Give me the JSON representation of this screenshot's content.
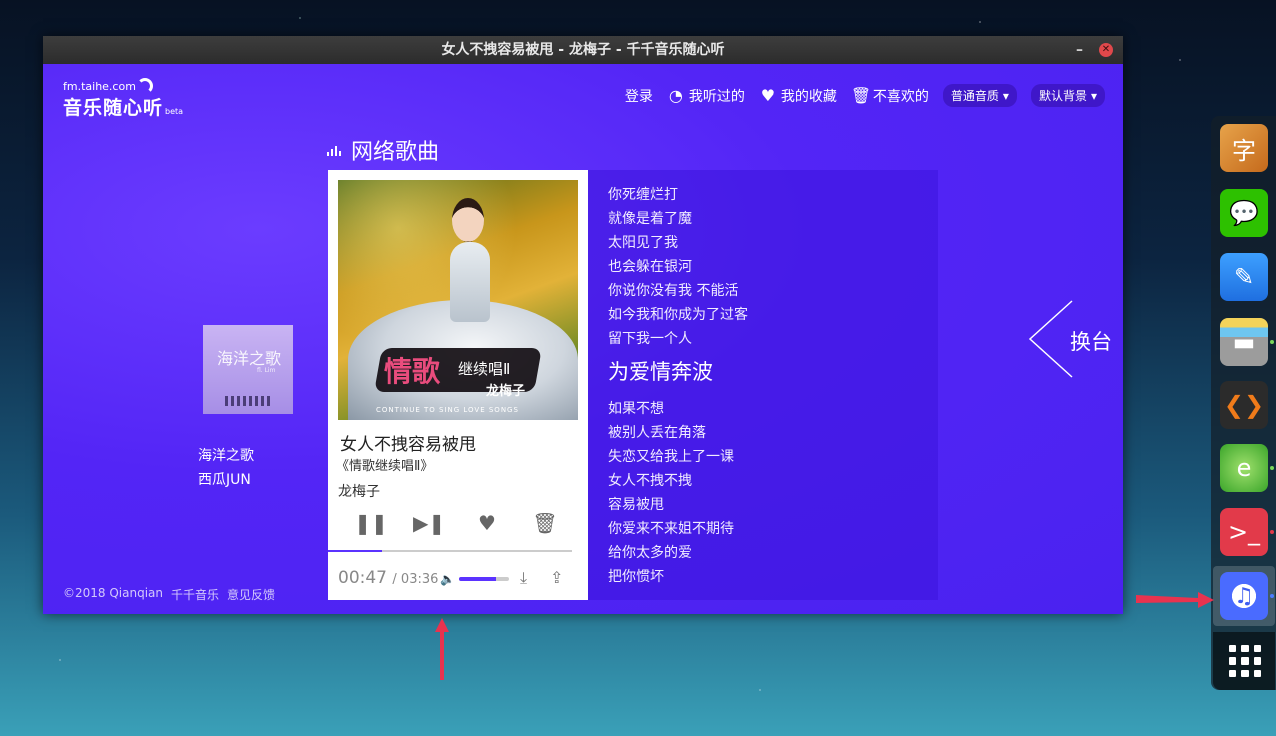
{
  "window": {
    "title": "女人不拽容易被甩 - 龙梅子 - 千千音乐随心听",
    "min": "–",
    "close": "✕"
  },
  "logo": {
    "url": "fm.taihe.com",
    "name": "音乐随心听",
    "tag": "beta"
  },
  "nav": {
    "login": "登录",
    "history": "我听过的",
    "favorites": "我的收藏",
    "disliked": "不喜欢的",
    "quality": "普通音质",
    "background": "默认背景"
  },
  "section_title": "网络歌曲",
  "previous": {
    "cover_text": "海洋之歌",
    "cover_sub": "fl. Lim",
    "title": "海洋之歌",
    "artist": "西瓜JUN"
  },
  "now_playing": {
    "cover_title": "情歌",
    "cover_subtitle": "继续唱Ⅱ",
    "cover_artist": "龙梅子",
    "cover_english": "CONTINUE TO SING LOVE SONGS",
    "title": "女人不拽容易被甩",
    "album": "《情歌继续唱Ⅱ》",
    "artist": "龙梅子",
    "elapsed": "00:47",
    "duration": "/ 03:36",
    "progress": 0.22,
    "volume": 0.75
  },
  "lyrics": {
    "lines_before": [
      "你死缠烂打",
      "就像是着了魔",
      "太阳见了我",
      "也会躲在银河",
      "你说你没有我 不能活",
      "如今我和你成为了过客",
      "留下我一个人"
    ],
    "current": "为爱情奔波",
    "lines_after": [
      "如果不想",
      "被别人丢在角落",
      "失恋又给我上了一课",
      "女人不拽不拽",
      "容易被甩",
      "你爱来不来姐不期待",
      "给你太多的爱",
      "把你惯坏"
    ]
  },
  "next_label": "换台",
  "footer": {
    "copyright": "©2018 Qianqian",
    "brand": "千千音乐",
    "feedback": "意见反馈"
  },
  "colors": {
    "app_bg": "#5a2bff",
    "accent": "#5b33ff",
    "arrow": "#e8334f"
  }
}
